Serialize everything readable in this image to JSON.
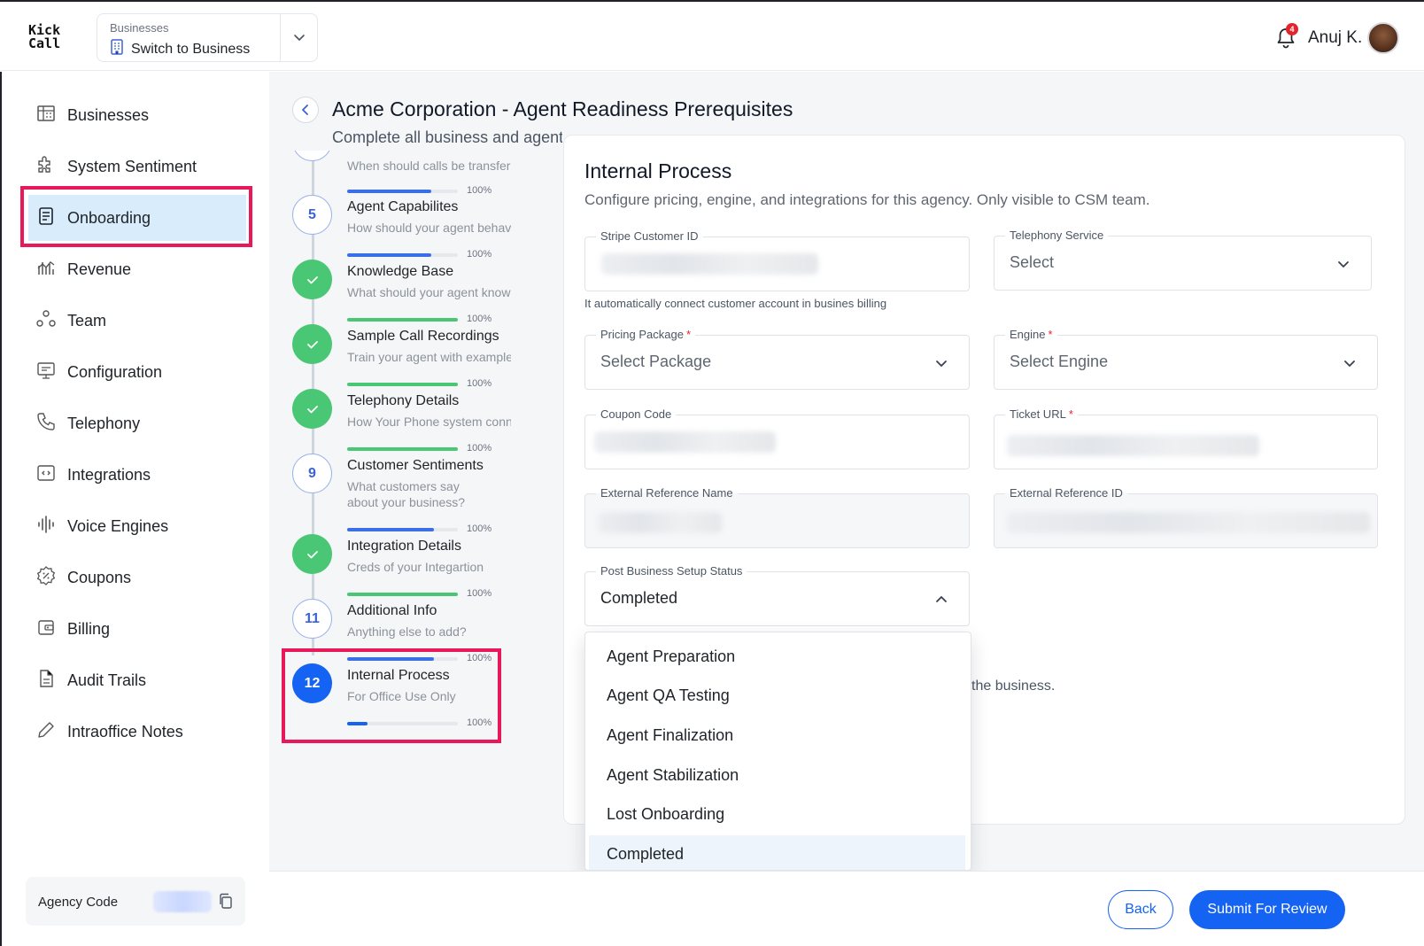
{
  "app": {
    "logo_line1": "Kick",
    "logo_line2": "Call"
  },
  "business_switcher": {
    "caption": "Businesses",
    "value": "Switch to Business"
  },
  "header": {
    "notification_count": "4",
    "user_name": "Anuj K."
  },
  "sidebar": {
    "items": [
      {
        "label": "Businesses",
        "icon": "building-icon"
      },
      {
        "label": "System Sentiment",
        "icon": "puzzle-icon"
      },
      {
        "label": "Onboarding",
        "icon": "document-icon",
        "active": true
      },
      {
        "label": "Revenue",
        "icon": "chart-icon"
      },
      {
        "label": "Team",
        "icon": "team-icon"
      },
      {
        "label": "Configuration",
        "icon": "monitor-icon"
      },
      {
        "label": "Telephony",
        "icon": "phone-icon"
      },
      {
        "label": "Integrations",
        "icon": "code-icon"
      },
      {
        "label": "Voice Engines",
        "icon": "waveform-icon"
      },
      {
        "label": "Coupons",
        "icon": "coupon-icon"
      },
      {
        "label": "Billing",
        "icon": "wallet-icon"
      },
      {
        "label": "Audit Trails",
        "icon": "file-icon"
      },
      {
        "label": "Intraoffice Notes",
        "icon": "pencil-icon"
      }
    ],
    "agency_code_label": "Agency Code"
  },
  "page": {
    "title": "Acme Corporation - Agent Readiness Prerequisites",
    "subtitle": "Complete all business and agent details to configure your AI agent"
  },
  "steps": [
    {
      "number": "",
      "title": "",
      "desc": "When should calls be transfer",
      "pct": "100%",
      "progress": 0.76,
      "state": "partial-top",
      "accent": "#3b6fe8"
    },
    {
      "number": "5",
      "title": "Agent Capabilites",
      "desc": "How should your agent behave",
      "pct": "100%",
      "progress": 0.76,
      "state": "num",
      "accent": "#3b6fe8"
    },
    {
      "number": "",
      "title": "Knowledge Base",
      "desc": "What should your agent know",
      "pct": "100%",
      "progress": 1.0,
      "state": "done",
      "accent": "#49c774"
    },
    {
      "number": "",
      "title": "Sample Call Recordings",
      "desc": "Train your agent with examples",
      "pct": "100%",
      "progress": 1.0,
      "state": "done",
      "accent": "#49c774"
    },
    {
      "number": "",
      "title": "Telephony Details",
      "desc": "How Your Phone system connects",
      "pct": "100%",
      "progress": 1.0,
      "state": "done",
      "accent": "#49c774"
    },
    {
      "number": "9",
      "title": "Customer Sentiments",
      "desc": "What customers say about your business?",
      "pct": "100%",
      "progress": 0.78,
      "state": "num",
      "accent": "#3b6fe8"
    },
    {
      "number": "",
      "title": "Integration Details",
      "desc": "Creds of your Integartion",
      "pct": "100%",
      "progress": 1.0,
      "state": "done",
      "accent": "#49c774"
    },
    {
      "number": "11",
      "title": "Additional Info",
      "desc": "Anything else to add?",
      "pct": "100%",
      "progress": 0.78,
      "state": "num",
      "accent": "#3b6fe8"
    },
    {
      "number": "12",
      "title": "Internal Process",
      "desc": "For Office Use Only",
      "pct": "100%",
      "progress": 0.18,
      "state": "current",
      "accent": "#1463f3"
    }
  ],
  "card": {
    "title": "Internal Process",
    "subtitle": "Configure pricing, engine, and integrations for this agency. Only visible to CSM team.",
    "fields": {
      "stripe_customer_id": {
        "label": "Stripe Customer ID"
      },
      "telephony_service": {
        "label": "Telephony Service",
        "value": "Select"
      },
      "stripe_helper": "It automatically connect customer account in busines billing",
      "pricing_package": {
        "label": "Pricing Package",
        "required": "*",
        "value": "Select Package"
      },
      "engine": {
        "label": "Engine",
        "required": "*",
        "value": "Select Engine"
      },
      "coupon_code": {
        "label": "Coupon Code"
      },
      "ticket_url": {
        "label": "Ticket URL",
        "required": "*"
      },
      "external_reference_name": {
        "label": "External Reference Name"
      },
      "external_reference_id": {
        "label": "External Reference ID"
      },
      "post_business_setup_status": {
        "label": "Post Business Setup Status",
        "value": "Completed"
      }
    },
    "behind_text": "the business.",
    "status_options": [
      {
        "label": "Agent Preparation",
        "selected": false
      },
      {
        "label": "Agent QA Testing",
        "selected": false
      },
      {
        "label": "Agent Finalization",
        "selected": false
      },
      {
        "label": "Agent Stabilization",
        "selected": false
      },
      {
        "label": "Lost Onboarding",
        "selected": false
      },
      {
        "label": "Completed",
        "selected": true
      }
    ]
  },
  "footer": {
    "back_label": "Back",
    "submit_label": "Submit For Review"
  },
  "colors": {
    "primary": "#1463f3",
    "success": "#49c774",
    "highlight": "#e8185b",
    "active_nav": "#d9ecfb"
  }
}
